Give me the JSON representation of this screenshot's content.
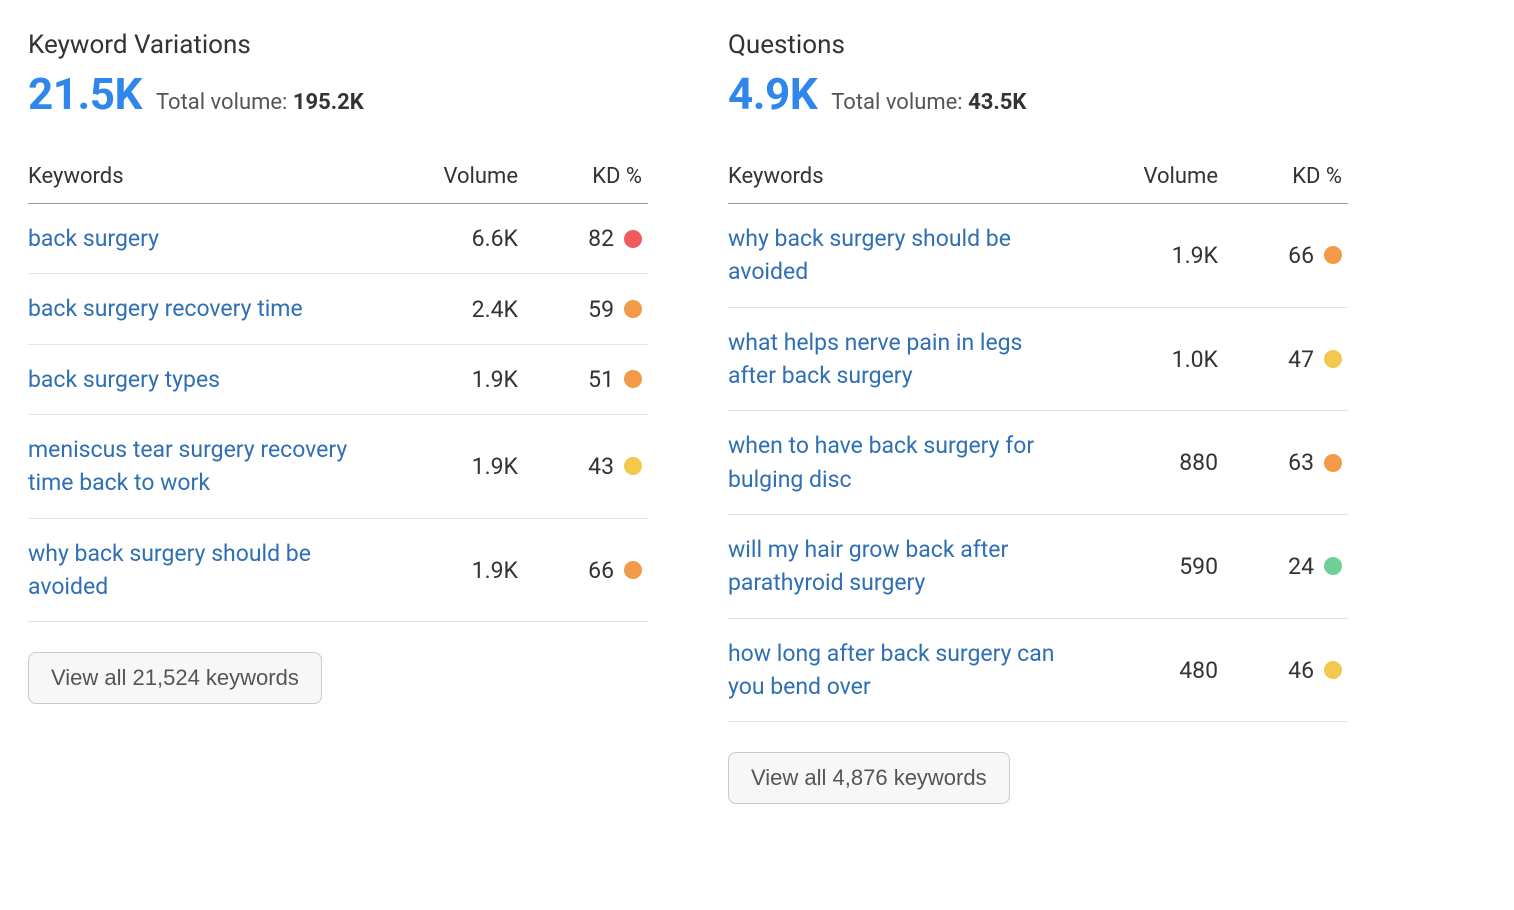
{
  "kd_colors": {
    "red": "#f05c5c",
    "orange": "#f2994a",
    "yellow": "#f2c94c",
    "green": "#6fcf97"
  },
  "panels": [
    {
      "title": "Keyword Variations",
      "main_metric": "21.5K",
      "sub_label": "Total volume: ",
      "sub_value": "195.2K",
      "headers": {
        "kw": "Keywords",
        "vol": "Volume",
        "kd": "KD %"
      },
      "rows": [
        {
          "keyword": "back surgery",
          "volume": "6.6K",
          "kd": "82",
          "kd_color": "red"
        },
        {
          "keyword": "back surgery recovery time",
          "volume": "2.4K",
          "kd": "59",
          "kd_color": "orange"
        },
        {
          "keyword": "back surgery types",
          "volume": "1.9K",
          "kd": "51",
          "kd_color": "orange"
        },
        {
          "keyword": "meniscus tear surgery recovery time back to work",
          "volume": "1.9K",
          "kd": "43",
          "kd_color": "yellow"
        },
        {
          "keyword": "why back surgery should be avoided",
          "volume": "1.9K",
          "kd": "66",
          "kd_color": "orange"
        }
      ],
      "view_all_label": "View all 21,524 keywords"
    },
    {
      "title": "Questions",
      "main_metric": "4.9K",
      "sub_label": "Total volume: ",
      "sub_value": "43.5K",
      "headers": {
        "kw": "Keywords",
        "vol": "Volume",
        "kd": "KD %"
      },
      "rows": [
        {
          "keyword": "why back surgery should be avoided",
          "volume": "1.9K",
          "kd": "66",
          "kd_color": "orange"
        },
        {
          "keyword": "what helps nerve pain in legs after back surgery",
          "volume": "1.0K",
          "kd": "47",
          "kd_color": "yellow"
        },
        {
          "keyword": "when to have back surgery for bulging disc",
          "volume": "880",
          "kd": "63",
          "kd_color": "orange"
        },
        {
          "keyword": "will my hair grow back after parathyroid surgery",
          "volume": "590",
          "kd": "24",
          "kd_color": "green"
        },
        {
          "keyword": "how long after back surgery can you bend over",
          "volume": "480",
          "kd": "46",
          "kd_color": "yellow"
        }
      ],
      "view_all_label": "View all 4,876 keywords"
    }
  ]
}
